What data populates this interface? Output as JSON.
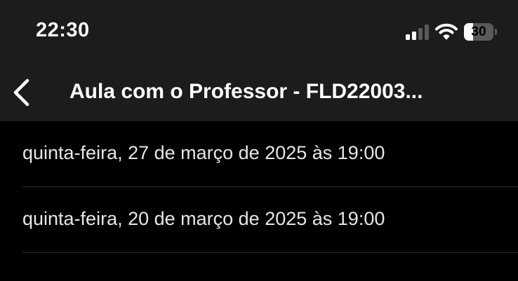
{
  "status_bar": {
    "time": "22:30",
    "battery_level": "30",
    "battery_fraction": 0.3,
    "signal_bars_active": 2,
    "signal_bars_total": 4,
    "icons": [
      "cellular-signal-icon",
      "wifi-icon",
      "battery-icon"
    ]
  },
  "nav": {
    "back_icon": "chevron-left-icon",
    "title": "Aula com o Professor - FLD22003..."
  },
  "sessions": [
    {
      "label": "quinta-feira, 27 de março de 2025 às 19:00"
    },
    {
      "label": "quinta-feira, 20 de março de 2025 às 19:00"
    }
  ],
  "colors": {
    "background": "#000000",
    "header_background": "#1c1c1e",
    "text": "#ffffff",
    "list_text": "#e6e6e6",
    "divider": "#2c2c2e",
    "inactive_signal": "#5a5a5c"
  }
}
